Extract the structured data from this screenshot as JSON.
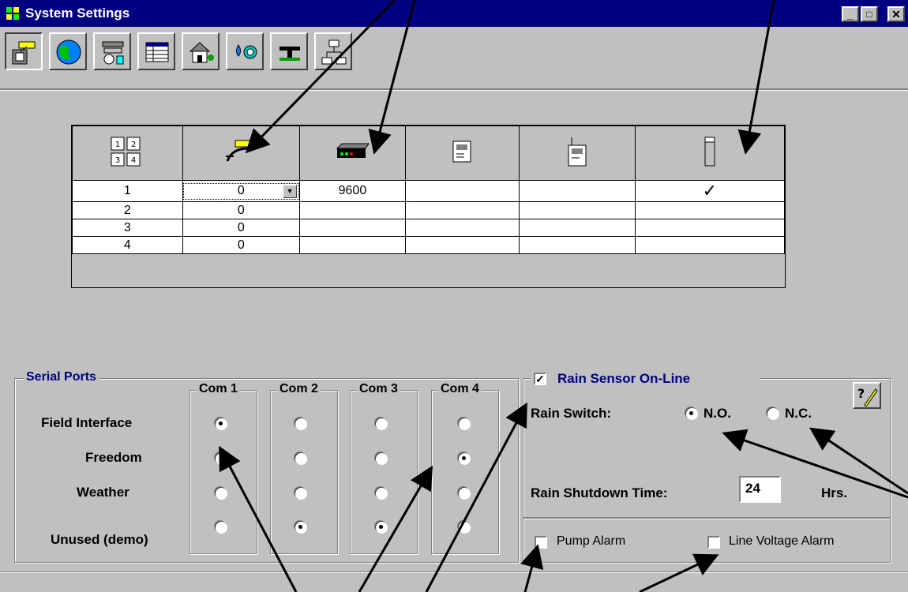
{
  "window": {
    "title": "System Settings",
    "min_glyph": "_",
    "max_glyph": "□",
    "close_glyph": "✕"
  },
  "toolbar": {
    "buttons": [
      {
        "name": "interface-tool-button",
        "icon": "interface-icon"
      },
      {
        "name": "globe-tool-button",
        "icon": "globe-icon"
      },
      {
        "name": "weather-tool-button",
        "icon": "weather-station-icon"
      },
      {
        "name": "schedule-tool-button",
        "icon": "table-icon"
      },
      {
        "name": "house-tool-button",
        "icon": "house-icon"
      },
      {
        "name": "water-tool-button",
        "icon": "water-meter-icon"
      },
      {
        "name": "pipe-tool-button",
        "icon": "pipe-icon"
      },
      {
        "name": "network-tool-button",
        "icon": "network-icon"
      }
    ]
  },
  "grid": {
    "header_icons": [
      "ports-icon",
      "field-interface-icon",
      "modem-icon",
      "controller-icon",
      "radio-icon",
      "sensor-icon"
    ],
    "rows": [
      {
        "port": "1",
        "interface": "0",
        "baud": "9600",
        "check": "✓"
      },
      {
        "port": "2",
        "interface": "0",
        "baud": "",
        "check": ""
      },
      {
        "port": "3",
        "interface": "0",
        "baud": "",
        "check": ""
      },
      {
        "port": "4",
        "interface": "0",
        "baud": "",
        "check": ""
      }
    ],
    "dropdown_arrow": "▼"
  },
  "serial": {
    "title": "Serial Ports",
    "com_labels": [
      "Com 1",
      "Com 2",
      "Com 3",
      "Com 4"
    ],
    "row_labels": [
      "Field Interface",
      "Freedom",
      "Weather",
      "Unused (demo)"
    ],
    "selected": {
      "com1": "Field Interface",
      "com2": "Unused (demo)",
      "com3": "Unused (demo)",
      "com4": "Freedom"
    }
  },
  "rain": {
    "online_label": "Rain Sensor On-Line",
    "online_checked": true,
    "switch_label": "Rain Switch:",
    "no_label": "N.O.",
    "nc_label": "N.C.",
    "switch_value": "N.O.",
    "shutdown_label": "Rain Shutdown Time:",
    "shutdown_value": "24",
    "shutdown_units": "Hrs.",
    "help_label": "?",
    "check_glyph": "✓"
  },
  "alarms": {
    "pump_label": "Pump Alarm",
    "line_voltage_label": "Line Voltage Alarm"
  },
  "colors": {
    "titlebar": "#000080",
    "face": "#c0c0c0",
    "accent_text": "#000080"
  }
}
